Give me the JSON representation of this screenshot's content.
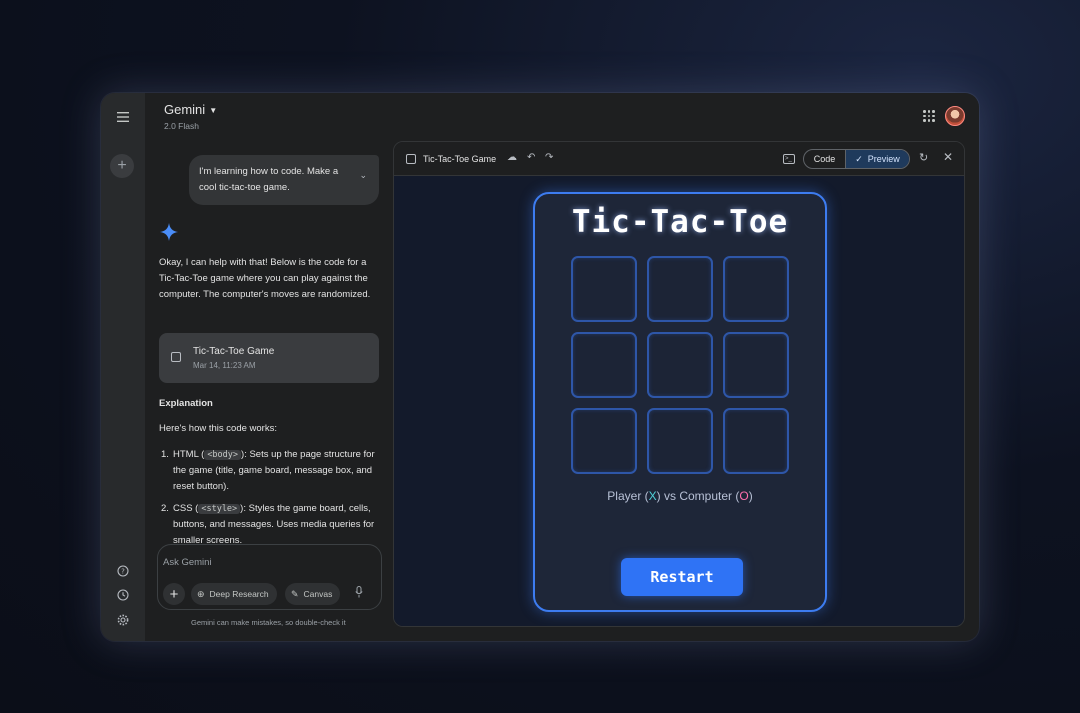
{
  "header": {
    "app_name": "Gemini",
    "model": "2.0 Flash"
  },
  "chat": {
    "user_message": "I'm learning how to code. Make a cool tic-tac-toe game.",
    "response_intro": "Okay, I can help with that! Below is the code for a Tic-Tac-Toe game where you can play against the computer. The computer's moves are randomized.",
    "doc_card": {
      "title": "Tic-Tac-Toe Game",
      "date": "Mar 14, 11:23 AM"
    },
    "explanation_heading": "Explanation",
    "explanation_intro": "Here's how this code works:",
    "list": [
      {
        "num": "1.",
        "pre": "HTML (",
        "code": "<body>",
        "post": "): Sets up the page structure for the game (title, game board, message box, and reset button)."
      },
      {
        "num": "2.",
        "pre": "CSS (",
        "code": "<style>",
        "post": "): Styles the game board, cells, buttons, and messages. Uses media queries for smaller screens."
      }
    ]
  },
  "input": {
    "placeholder": "Ask Gemini",
    "deep_research": "Deep Research",
    "canvas": "Canvas",
    "disclaimer": "Gemini can make mistakes, so double-check it"
  },
  "canvas_panel": {
    "title": "Tic-Tac-Toe Game",
    "code_label": "Code",
    "preview_label": "Preview"
  },
  "game": {
    "title": "Tic-Tac-Toe",
    "status_player": "Player (",
    "status_x": "X",
    "status_vs": ") vs Computer (",
    "status_o": "O",
    "status_end": ")",
    "restart_label": "Restart",
    "x_color": "#4fd1d9",
    "o_color": "#ff6fae",
    "accent": "#3d7cf0"
  },
  "icons": [
    "menu-icon",
    "plus-icon",
    "help-icon",
    "history-icon",
    "settings-icon",
    "apps-icon",
    "sparkle-icon",
    "document-icon",
    "cloud-icon",
    "undo-icon",
    "redo-icon",
    "terminal-icon",
    "check-icon",
    "refresh-icon",
    "close-icon",
    "mic-icon"
  ]
}
